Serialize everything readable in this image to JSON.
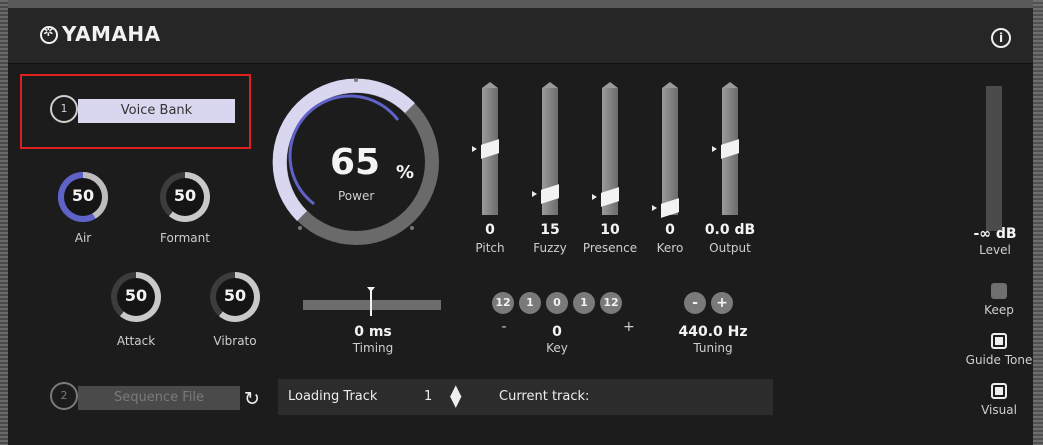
{
  "brand": "YAMAHA",
  "info_icon": "info-circle-icon",
  "voice_bank": {
    "number": "1",
    "label": "Voice Bank"
  },
  "sequence_file": {
    "number": "2",
    "label": "Sequence File"
  },
  "power": {
    "value": "65",
    "unit": "%",
    "label": "Power",
    "level_fraction": 0.65
  },
  "knobs": {
    "air": {
      "value": "50",
      "label": "Air"
    },
    "formant": {
      "value": "50",
      "label": "Formant"
    },
    "attack": {
      "value": "50",
      "label": "Attack"
    },
    "vibrato": {
      "value": "50",
      "label": "Vibrato"
    }
  },
  "faders": [
    {
      "id": "pitch",
      "value": "0",
      "label": "Pitch",
      "level_fraction": 0.52
    },
    {
      "id": "fuzzy",
      "value": "15",
      "label": "Fuzzy",
      "level_fraction": 0.12
    },
    {
      "id": "presence",
      "value": "10",
      "label": "Presence",
      "level_fraction": 0.1
    },
    {
      "id": "kero",
      "value": "0",
      "label": "Kero",
      "level_fraction": 0.0
    },
    {
      "id": "output",
      "value": "0.0 dB",
      "label": "Output",
      "level_fraction": 0.52
    }
  ],
  "timing": {
    "value": "0 ms",
    "label": "Timing"
  },
  "key": {
    "buttons": [
      "12",
      "1",
      "0",
      "1",
      "12"
    ],
    "minus": "-",
    "plus": "+",
    "value": "0",
    "label": "Key"
  },
  "tuning": {
    "minus": "-",
    "plus": "+",
    "value": "440.0 Hz",
    "label": "Tuning"
  },
  "level": {
    "value": "-∞ dB",
    "label": "Level"
  },
  "toggles": {
    "keep": "Keep",
    "guide_tone": "Guide Tone",
    "visual": "Visual"
  },
  "loading_track": {
    "label": "Loading Track",
    "value": "1"
  },
  "current_track": {
    "label": "Current track:"
  },
  "colors": {
    "accent": "#5f63c8",
    "ring_light": "#d9d6ef",
    "highlight": "#e02020"
  }
}
